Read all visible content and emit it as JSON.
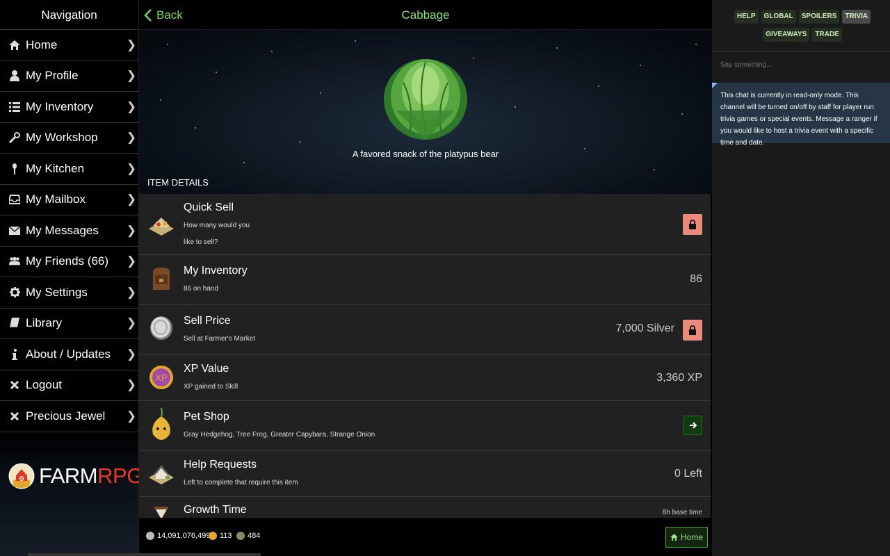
{
  "nav": {
    "header": "Navigation",
    "items": [
      {
        "label": "Home",
        "icon": "home-icon"
      },
      {
        "label": "My Profile",
        "icon": "user-icon"
      },
      {
        "label": "My Inventory",
        "icon": "list-icon"
      },
      {
        "label": "My Workshop",
        "icon": "wrench-icon"
      },
      {
        "label": "My Kitchen",
        "icon": "spoon-icon"
      },
      {
        "label": "My Mailbox",
        "icon": "inbox-icon"
      },
      {
        "label": "My Messages",
        "icon": "envelope-icon"
      },
      {
        "label": "My Friends (66)",
        "icon": "friends-icon"
      },
      {
        "label": "My Settings",
        "icon": "gear-icon"
      },
      {
        "label": "Library",
        "icon": "book-icon"
      },
      {
        "label": "About / Updates",
        "icon": "info-icon"
      },
      {
        "label": "Logout",
        "icon": "x-icon"
      },
      {
        "label": "Precious Jewel",
        "icon": "x-icon"
      }
    ],
    "logo": {
      "farm": "FARM",
      "rpg": "RPG",
      "tm": "™"
    }
  },
  "topbar": {
    "back_label": "Back",
    "title": "Cabbage"
  },
  "item": {
    "description": "A favored snack of the platypus bear",
    "section_label": "ITEM DETAILS"
  },
  "details": [
    {
      "title": "Quick Sell",
      "sub1": "How many would you",
      "sub2": "like to sell?",
      "value": "",
      "icon": "quick-sell-icon"
    },
    {
      "title": "My Inventory",
      "sub1": "86 on hand",
      "value": "86",
      "icon": "backpack-icon"
    },
    {
      "title": "Sell Price",
      "sub1": "Sell at Farmer's Market",
      "value": "7,000 Silver",
      "icon": "silver-coin-icon"
    },
    {
      "title": "XP Value",
      "sub1": "XP gained to Skill",
      "value": "3,360 XP",
      "icon": "xp-icon"
    },
    {
      "title": "Pet Shop",
      "sub1": "Gray Hedgehog, Tree Frog, Greater Capybara, Strange Onion",
      "value": "",
      "icon": "onion-pet-icon"
    },
    {
      "title": "Help Requests",
      "sub1": "Left to complete that require this item",
      "value": "0 Left",
      "icon": "farm-house-icon"
    },
    {
      "title": "Growth Time",
      "sub1": "",
      "value": "8h base time",
      "icon": "hourglass-icon"
    }
  ],
  "footer": {
    "silver": "14,091,076,499",
    "gold": "113",
    "third": "484",
    "home_label": "Home"
  },
  "chat": {
    "tabs": [
      "HELP",
      "GLOBAL",
      "SPOILERS",
      "TRIVIA",
      "GIVEAWAYS",
      "TRADE"
    ],
    "active_tab": "TRIVIA",
    "placeholder": "Say something...",
    "notice": "This chat is currently in read-only mode. This channel will be turned on/off by staff for player run trivia games or special events. Message a ranger if you would like to host a trivia event with a specific time and date."
  },
  "colors": {
    "accent_green": "#8fe07a",
    "lock_red": "#e98a7c",
    "notice_bg": "#263646"
  }
}
